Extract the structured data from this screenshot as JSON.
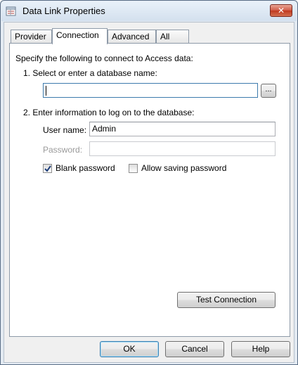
{
  "window": {
    "title": "Data Link Properties",
    "close_glyph": "✕"
  },
  "tabs": [
    {
      "label": "Provider",
      "active": false
    },
    {
      "label": "Connection",
      "active": true
    },
    {
      "label": "Advanced",
      "active": false
    },
    {
      "label": "All",
      "active": false
    }
  ],
  "connection": {
    "intro": "Specify the following to connect to Access data:",
    "step1_label": "1. Select or enter a database name:",
    "database_value": "",
    "browse_label": "...",
    "step2_label": "2. Enter information to log on to the database:",
    "username_label": "User name:",
    "username_value": "Admin",
    "password_label": "Password:",
    "password_value": "",
    "blank_password_label": "Blank password",
    "blank_password_checked": true,
    "allow_saving_label": "Allow saving password",
    "allow_saving_checked": false,
    "test_connection_label": "Test Connection"
  },
  "footer": {
    "ok_label": "OK",
    "cancel_label": "Cancel",
    "help_label": "Help"
  }
}
